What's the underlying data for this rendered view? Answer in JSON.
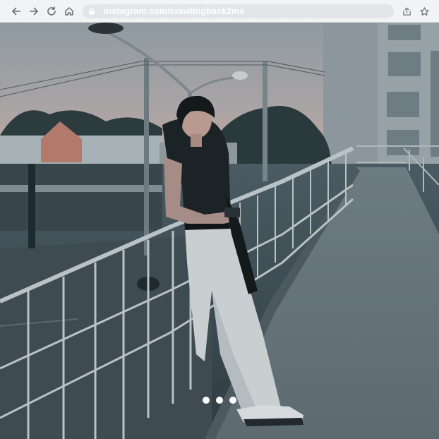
{
  "browser": {
    "url": "instagram.com/crawlingback2me",
    "icons": {
      "back": "arrow-left-icon",
      "forward": "arrow-right-icon",
      "reload": "reload-icon",
      "home": "home-icon",
      "security": "lock-icon",
      "share": "share-icon",
      "bookmark": "star-icon"
    }
  },
  "post": {
    "image": "photo of a young man in a black t-shirt and white wide-leg trousers leaning on the railing of a pedestrian overpass at dusk",
    "carousel": {
      "count": 3,
      "active": 1
    }
  },
  "colors": {
    "toolbar_bg": "#f1f3f4",
    "omnibox_bg": "#e3e5e8",
    "url_text": "#ffffff",
    "icon": "#6b6f73",
    "sky": "#9aa2a6",
    "dusk_glow": "#c9a79a"
  }
}
